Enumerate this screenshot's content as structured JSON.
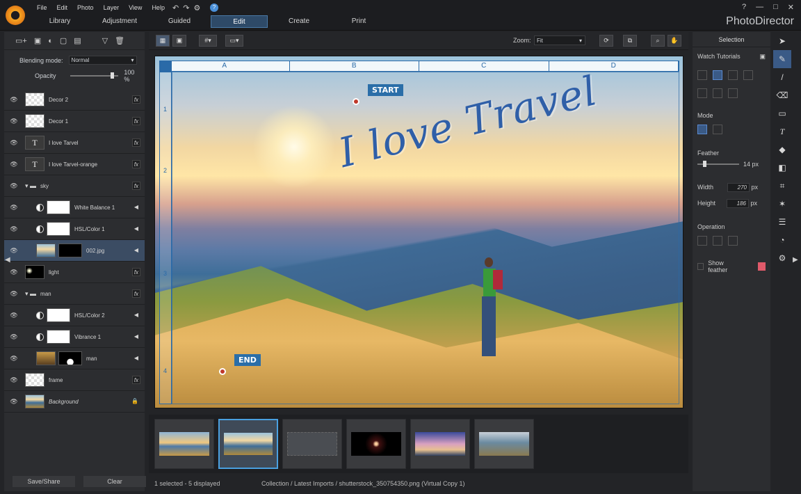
{
  "menu": [
    "File",
    "Edit",
    "Photo",
    "Layer",
    "View",
    "Help"
  ],
  "tabs": [
    "Library",
    "Adjustment",
    "Guided",
    "Edit",
    "Create",
    "Print"
  ],
  "active_tab": "Edit",
  "brand": "PhotoDirector",
  "window_controls": [
    "?",
    "—",
    "□",
    "✕"
  ],
  "left": {
    "blending_label": "Blending mode:",
    "blending_value": "Normal",
    "opacity_label": "Opacity",
    "opacity_value": "100 %",
    "layers": [
      {
        "name": "Decor 2",
        "kind": "checker",
        "right": "fx"
      },
      {
        "name": "Decor 1",
        "kind": "checker",
        "right": "fx"
      },
      {
        "name": "I love Tarvel",
        "kind": "text",
        "right": "fx"
      },
      {
        "name": "I love Tarvel-orange",
        "kind": "text",
        "right": "fx"
      },
      {
        "name": "sky",
        "kind": "folder",
        "right": "fx"
      },
      {
        "name": "White Balance 1",
        "kind": "adj",
        "right": "arrow"
      },
      {
        "name": "HSL/Color 1",
        "kind": "adj",
        "right": "arrow"
      },
      {
        "name": "002.jpg",
        "kind": "photo",
        "right": "arrow"
      },
      {
        "name": "light",
        "kind": "dark",
        "right": "fx"
      },
      {
        "name": "man",
        "kind": "folder",
        "right": "fx"
      },
      {
        "name": "HSL/Color 2",
        "kind": "adj",
        "right": "arrow"
      },
      {
        "name": "Vibrance 1",
        "kind": "adj",
        "right": "arrow"
      },
      {
        "name": "man",
        "kind": "photo2",
        "right": "arrow"
      },
      {
        "name": "frame",
        "kind": "checker",
        "right": "fx"
      },
      {
        "name": "Background",
        "kind": "bg",
        "right": "lock"
      }
    ],
    "save_share": "Save/Share",
    "clear": "Clear"
  },
  "center": {
    "zoom_label": "Zoom:",
    "zoom_value": "Fit",
    "ruler_cols": [
      "A",
      "B",
      "C",
      "D"
    ],
    "ruler_rows": [
      "1",
      "2",
      "3",
      "4"
    ],
    "art_text": "I love Travel",
    "pin_start": "START",
    "pin_end": "END"
  },
  "status": {
    "selected": "1 selected - 5 displayed",
    "path": "Collection / Latest Imports / shutterstock_350754350.png (Virtual Copy 1)"
  },
  "right": {
    "title": "Selection",
    "watch": "Watch Tutorials",
    "mode": "Mode",
    "feather": "Feather",
    "feather_value": "14 px",
    "width_label": "Width",
    "width_value": "270",
    "height_label": "Height",
    "height_value": "186",
    "px": "px",
    "operation": "Operation",
    "show_feather": "Show feather",
    "feather_color": "#e05a6a"
  },
  "colors": {
    "accent": "#2e4a68",
    "selected_layer": "#3b4c63",
    "pin": "#2a6ea8"
  }
}
